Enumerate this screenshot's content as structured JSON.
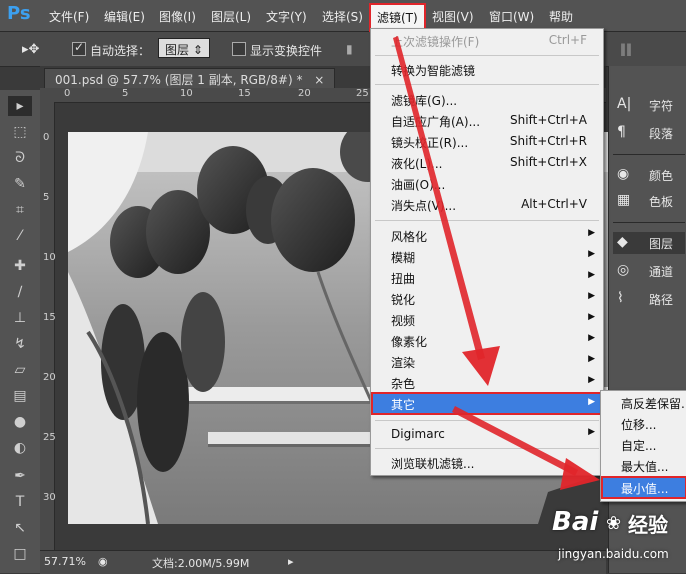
{
  "app": {
    "logo": "Ps"
  },
  "menubar": {
    "items": [
      "文件(F)",
      "编辑(E)",
      "图像(I)",
      "图层(L)",
      "文字(Y)",
      "选择(S)",
      "滤镜(T)",
      "视图(V)",
      "窗口(W)",
      "帮助"
    ],
    "active_index": 6
  },
  "options": {
    "auto_select_label": "自动选择：",
    "auto_select_value": "图层",
    "show_transform_label": "显示变换控件"
  },
  "document_tab": {
    "title": "001.psd @ 57.7% (图层 1 副本, RGB/8#) *",
    "close": "×"
  },
  "ruler": {
    "top": [
      "0",
      "5",
      "10",
      "15",
      "20",
      "25"
    ],
    "left": [
      "0",
      "5",
      "10",
      "15",
      "20",
      "25",
      "30"
    ]
  },
  "statusbar": {
    "zoom": "57.71%",
    "doc_info": "文档:2.00M/5.99M"
  },
  "right_panel": {
    "items": [
      {
        "icon": "A|",
        "label": "字符"
      },
      {
        "icon": "¶",
        "label": "段落"
      },
      {
        "icon": "◉",
        "label": "颜色"
      },
      {
        "icon": "▦",
        "label": "色板"
      },
      {
        "icon": "◆",
        "label": "图层"
      },
      {
        "icon": "◎",
        "label": "通道"
      },
      {
        "icon": "⌇",
        "label": "路径"
      }
    ]
  },
  "filter_menu": {
    "items": [
      {
        "label": "上次滤镜操作(F)",
        "shortcut": "Ctrl+F",
        "disabled": true
      },
      {
        "label": "转换为智能滤镜"
      },
      {
        "label": "滤镜库(G)..."
      },
      {
        "label": "自适应广角(A)...",
        "shortcut": "Shift+Ctrl+A"
      },
      {
        "label": "镜头校正(R)...",
        "shortcut": "Shift+Ctrl+R"
      },
      {
        "label": "液化(L)...",
        "shortcut": "Shift+Ctrl+X"
      },
      {
        "label": "油画(O)..."
      },
      {
        "label": "消失点(V)...",
        "shortcut": "Alt+Ctrl+V"
      },
      {
        "label": "风格化",
        "submenu": true
      },
      {
        "label": "模糊",
        "submenu": true
      },
      {
        "label": "扭曲",
        "submenu": true
      },
      {
        "label": "锐化",
        "submenu": true
      },
      {
        "label": "视频",
        "submenu": true
      },
      {
        "label": "像素化",
        "submenu": true
      },
      {
        "label": "渲染",
        "submenu": true
      },
      {
        "label": "杂色",
        "submenu": true
      },
      {
        "label": "其它",
        "submenu": true,
        "highlighted": true
      },
      {
        "label": "Digimarc",
        "submenu": true
      },
      {
        "label": "浏览联机滤镜..."
      }
    ]
  },
  "other_submenu": {
    "items": [
      {
        "label": "高反差保留..."
      },
      {
        "label": "位移..."
      },
      {
        "label": "自定..."
      },
      {
        "label": "最大值..."
      },
      {
        "label": "最小值...",
        "highlighted": true
      }
    ]
  },
  "watermark": {
    "brand": "Bai",
    "brand_cn": "经验",
    "url": "jingyan.baidu.com"
  },
  "colors": {
    "accent": "#e0252a",
    "highlight": "#3d7ee0",
    "ui_bg": "#535353"
  }
}
